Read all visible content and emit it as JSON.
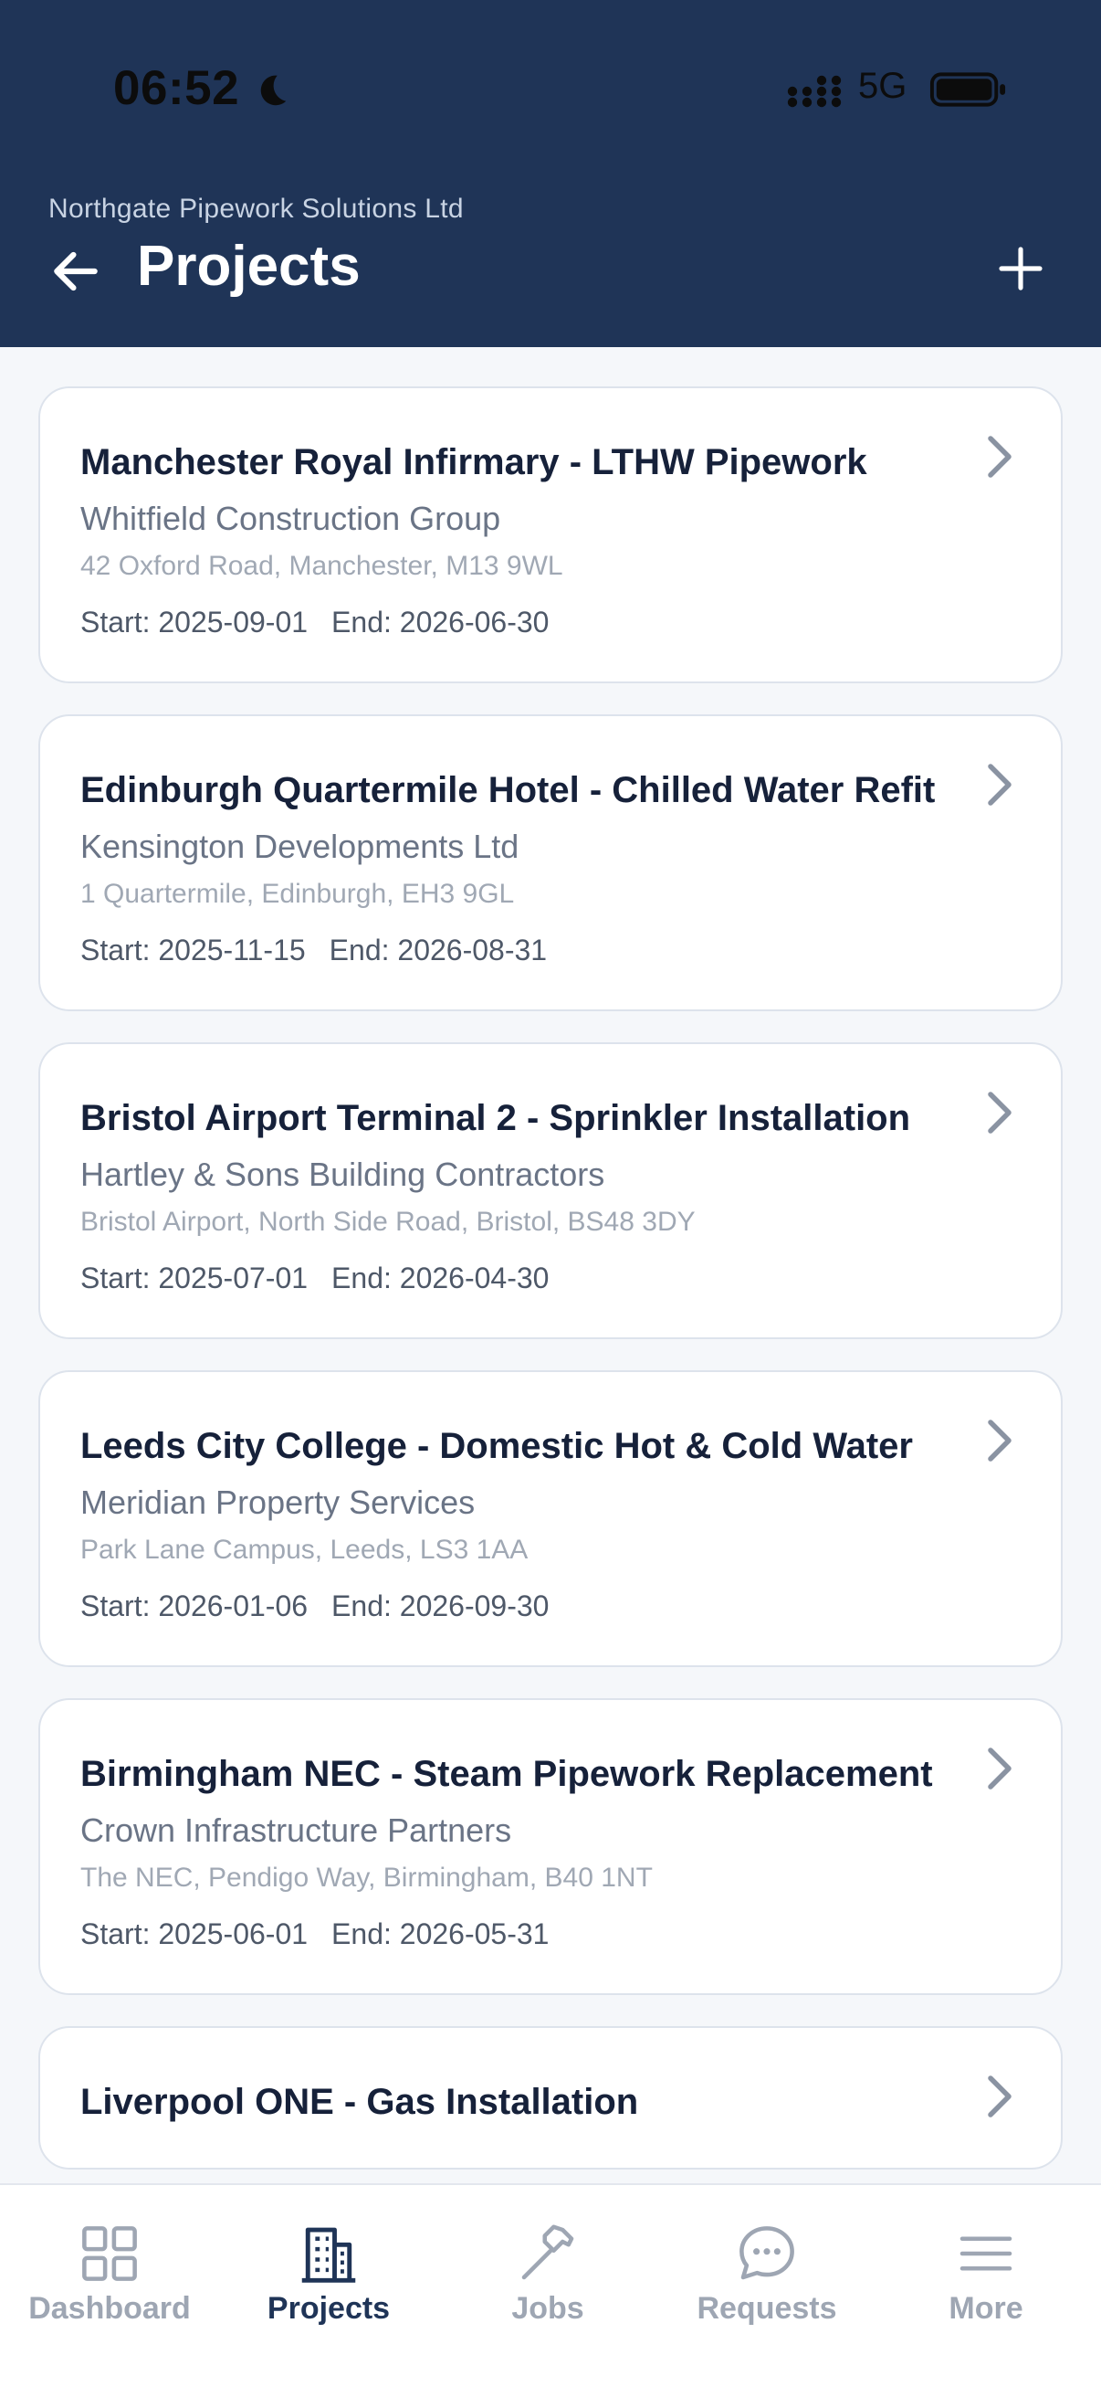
{
  "status_bar": {
    "time": "06:52",
    "network": "5G"
  },
  "header": {
    "company": "Northgate Pipework Solutions Ltd",
    "title": "Projects"
  },
  "projects": [
    {
      "title": "Manchester Royal Infirmary - LTHW Pipework",
      "client": "Whitfield Construction Group",
      "address": "42 Oxford Road, Manchester, M13 9WL",
      "start": "Start: 2025-09-01",
      "end": "End: 2026-06-30"
    },
    {
      "title": "Edinburgh Quartermile Hotel - Chilled Water Refit",
      "client": "Kensington Developments Ltd",
      "address": "1 Quartermile, Edinburgh, EH3 9GL",
      "start": "Start: 2025-11-15",
      "end": "End: 2026-08-31"
    },
    {
      "title": "Bristol Airport Terminal 2 - Sprinkler Installation",
      "client": "Hartley & Sons Building Contractors",
      "address": "Bristol Airport, North Side Road, Bristol, BS48 3DY",
      "start": "Start: 2025-07-01",
      "end": "End: 2026-04-30"
    },
    {
      "title": "Leeds City College - Domestic Hot & Cold Water",
      "client": "Meridian Property Services",
      "address": "Park Lane Campus, Leeds, LS3 1AA",
      "start": "Start: 2026-01-06",
      "end": "End: 2026-09-30"
    },
    {
      "title": "Birmingham NEC - Steam Pipework Replacement",
      "client": "Crown Infrastructure Partners",
      "address": "The NEC, Pendigo Way, Birmingham, B40 1NT",
      "start": "Start: 2025-06-01",
      "end": "End: 2026-05-31"
    },
    {
      "title": "Liverpool ONE - Gas Installation",
      "client": "",
      "address": "",
      "start": "",
      "end": ""
    }
  ],
  "tabs": [
    {
      "label": "Dashboard",
      "icon": "grid-icon",
      "active": false
    },
    {
      "label": "Projects",
      "icon": "building-icon",
      "active": true
    },
    {
      "label": "Jobs",
      "icon": "hammer-icon",
      "active": false
    },
    {
      "label": "Requests",
      "icon": "chat-bubble-icon",
      "active": false
    },
    {
      "label": "More",
      "icon": "menu-icon",
      "active": false
    }
  ],
  "colors": {
    "header_bg": "#1f3457",
    "active_tab": "#1f3457",
    "inactive_tab": "#9ea6b3",
    "page_bg": "#f5f7fa"
  }
}
